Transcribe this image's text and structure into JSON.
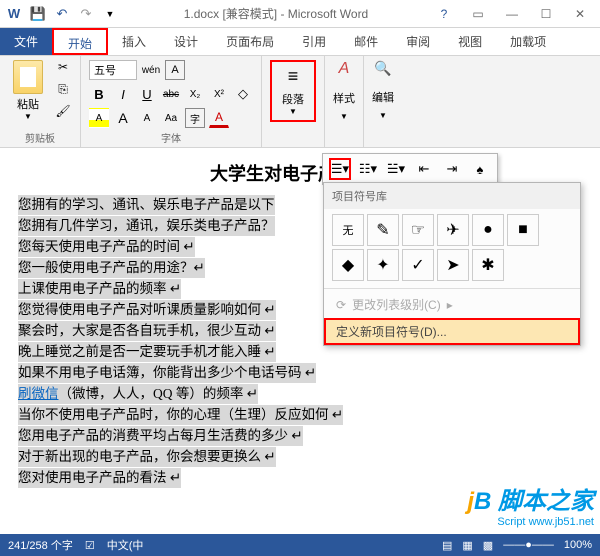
{
  "titlebar": {
    "title": "1.docx [兼容模式] - Microsoft Word"
  },
  "tabs": {
    "file": "文件",
    "home": "开始",
    "insert": "插入",
    "design": "设计",
    "layout": "页面布局",
    "references": "引用",
    "mailings": "邮件",
    "review": "审阅",
    "view": "视图",
    "addins": "加载项"
  },
  "ribbon": {
    "clipboard": {
      "paste": "粘贴",
      "label": "剪贴板"
    },
    "font": {
      "size": "五号",
      "subfont": "wén",
      "label": "字体",
      "buttons": {
        "bold": "B",
        "italic": "I",
        "underline": "U",
        "strike": "abc",
        "sub": "X₂",
        "sup": "X²",
        "grow": "A",
        "shrink": "A",
        "case": "Aa",
        "field": "字"
      }
    },
    "paragraph": {
      "label": "段落"
    },
    "styles": {
      "label": "样式"
    },
    "editing": {
      "label": "编辑"
    }
  },
  "document": {
    "title": "大学生对电子产品的使",
    "lines": [
      "您拥有的学习、通讯、娱乐电子产品是以下",
      "您拥有几件学习，通讯，娱乐类电子产品？",
      "您每天使用电子产品的时间 ↵",
      "您一般使用电子产品的用途？↵",
      "上课使用电子产品的频率 ↵",
      "您觉得使用电子产品对听课质量影响如何 ↵",
      "聚会时，大家是否各自玩手机，很少互动 ↵",
      "晚上睡觉之前是否一定要玩手机才能入睡 ↵",
      "如果不用电子电话簿，你能背出多少个电话号码 ↵",
      "刷微信（微博，人人，QQ 等）的频率 ↵",
      "当你不使用电子产品时，你的心理（生理）反应如何 ↵",
      "您用电子产品的消费平均占每月生活费的多少 ↵",
      "对于新出现的电子产品，你会想要更换么 ↵",
      "您对使用电子产品的看法 ↵"
    ],
    "link_text": "刷微信"
  },
  "bullet_panel": {
    "library_header": "项目符号库",
    "none": "无",
    "change_level": "更改列表级别(C)",
    "define_new": "定义新项目符号(D)...",
    "bullets": [
      "●",
      "◆",
      "✦",
      "✓",
      "➤",
      "✱"
    ]
  },
  "statusbar": {
    "pages": "241/258 个字",
    "lang": "中文(中",
    "zoom": "100%"
  },
  "watermark": {
    "brand": "脚本之家",
    "url": "www.jb51.net",
    "script": "Script"
  }
}
